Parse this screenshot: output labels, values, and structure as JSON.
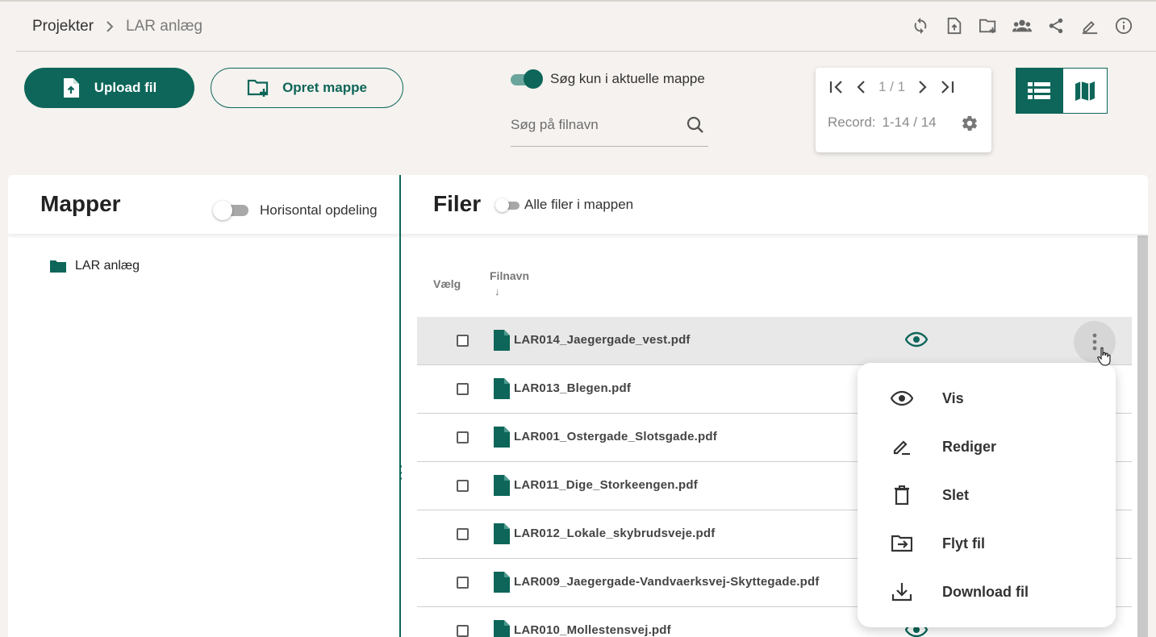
{
  "breadcrumb": {
    "root": "Projekter",
    "current": "LAR anlæg"
  },
  "header_icons": [
    "sync-icon",
    "file-upload-icon",
    "folder-add-icon",
    "group-icon",
    "share-icon",
    "edit-icon",
    "info-icon"
  ],
  "actions": {
    "upload_label": "Upload fil",
    "create_folder_label": "Opret mappe"
  },
  "search": {
    "toggle_label": "Søg kun i aktuelle mappe",
    "toggle_on": true,
    "placeholder": "Søg på filnavn"
  },
  "pager": {
    "page": "1 / 1",
    "record_label": "Record:",
    "record_value": "1-14 / 14"
  },
  "views": {
    "active": "list",
    "options": [
      "list",
      "map"
    ]
  },
  "mapper": {
    "title": "Mapper",
    "split_label": "Horisontal opdeling",
    "folders": [
      "LAR anlæg"
    ]
  },
  "filer": {
    "title": "Filer",
    "all_files_label": "Alle filer i mappen",
    "col_select": "Vælg",
    "col_name": "Filnavn",
    "sort_arrow": "↓",
    "files": [
      "LAR014_Jaegergade_vest.pdf",
      "LAR013_Blegen.pdf",
      "LAR001_Ostergade_Slotsgade.pdf",
      "LAR011_Dige_Storkeengen.pdf",
      "LAR012_Lokale_skybrudsveje.pdf",
      "LAR009_Jaegergade-Vandvaerksvej-Skyttegade.pdf",
      "LAR010_Mollestensvej.pdf"
    ]
  },
  "context_menu": {
    "items": [
      {
        "label": "Vis",
        "icon": "eye-icon"
      },
      {
        "label": "Rediger",
        "icon": "edit-icon"
      },
      {
        "label": "Slet",
        "icon": "trash-icon"
      },
      {
        "label": "Flyt fil",
        "icon": "move-folder-icon"
      },
      {
        "label": "Download fil",
        "icon": "download-icon"
      }
    ]
  },
  "colors": {
    "primary": "#0d6659",
    "background": "#f5f2ef"
  }
}
